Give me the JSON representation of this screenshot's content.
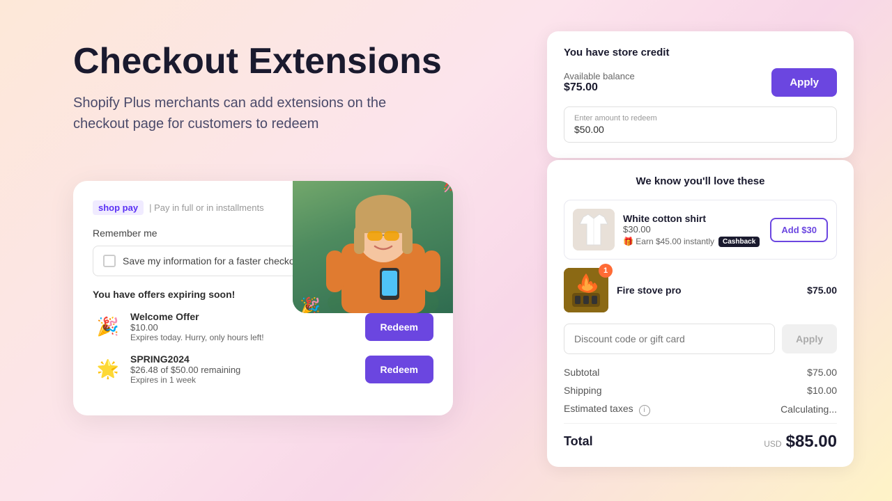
{
  "hero": {
    "title": "Checkout Extensions",
    "subtitle": "Shopify Plus merchants can add extensions on the checkout page for customers to redeem"
  },
  "checkout_card": {
    "shoppay_label": "shop pay",
    "shoppay_installments": "| Pay in full or in installments",
    "remember_me": "Remember me",
    "checkbox_label": "Save my information for a faster checkout",
    "offers_heading": "You have offers expiring soon!",
    "offers": [
      {
        "icon": "🎉",
        "name": "Welcome Offer",
        "amount": "$10.00",
        "expires": "Expires today. Hurry, only hours left!",
        "redeem_label": "Redeem"
      },
      {
        "icon": "⭐",
        "name": "SPRING2024",
        "amount": "$26.48 of $50.00 remaining",
        "expires": "Expires in 1 week",
        "redeem_label": "Redeem"
      }
    ]
  },
  "store_credit": {
    "title": "You have store credit",
    "balance_label": "Available balance",
    "balance_amount": "$75.00",
    "apply_label": "Apply",
    "input_label": "Enter amount to redeem",
    "input_value": "$50.00"
  },
  "recommendations": {
    "title": "We know you'll love these",
    "products": [
      {
        "name": "White cotton shirt",
        "price": "$30.00",
        "cashback_text": "🎁 Earn $45.00 instantly",
        "cashback_badge": "Cashback",
        "add_label": "Add $30"
      }
    ],
    "fire_product": {
      "name": "Fire stove pro",
      "price": "$75.00",
      "badge": "1"
    },
    "discount_placeholder": "Discount code or gift card",
    "apply_label": "Apply",
    "subtotal_label": "Subtotal",
    "subtotal_value": "$75.00",
    "shipping_label": "Shipping",
    "shipping_value": "$10.00",
    "taxes_label": "Estimated taxes",
    "taxes_value": "Calculating...",
    "total_label": "Total",
    "total_usd": "USD",
    "total_value": "$85.00"
  }
}
